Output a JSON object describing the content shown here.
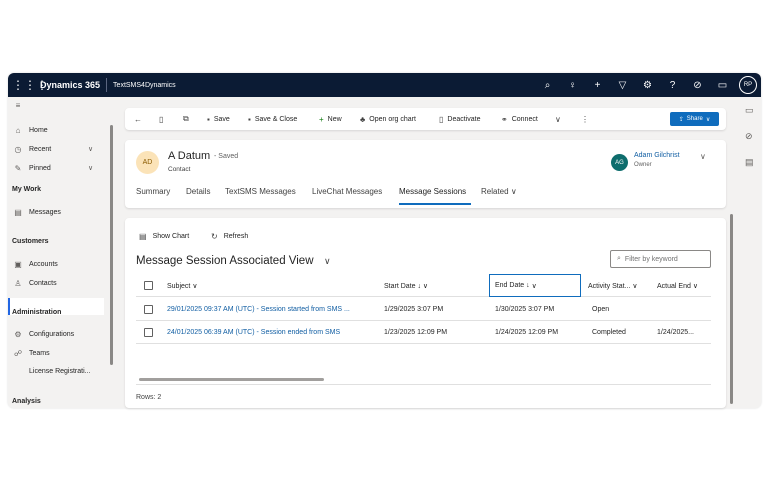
{
  "topbar": {
    "product": "Dynamics 365",
    "app_name": "TextSMS4Dynamics",
    "icons": [
      "search-icon",
      "lightbulb-icon",
      "plus-icon",
      "filter-icon",
      "settings-icon",
      "help-icon",
      "remote-assist-icon",
      "chat-icon"
    ],
    "user_initials": "RP"
  },
  "sidebar": {
    "home": "Home",
    "recent": "Recent",
    "pinned": "Pinned",
    "my_work_heading": "My Work",
    "messages": "Messages",
    "customers_heading": "Customers",
    "accounts": "Accounts",
    "contacts": "Contacts",
    "administration_heading": "Administration",
    "configurations": "Configurations",
    "teams": "Teams",
    "license": "License Registrati...",
    "analysis_heading": "Analysis"
  },
  "commandbar": {
    "save": "Save",
    "save_close": "Save & Close",
    "new": "New",
    "org_chart": "Open org chart",
    "deactivate": "Deactivate",
    "connect": "Connect",
    "share": "Share"
  },
  "record": {
    "initials": "AD",
    "name": "A Datum",
    "saved_status": "- Saved",
    "entity": "Contact",
    "owner_initials": "AG",
    "owner_name": "Adam Gilchrist",
    "owner_role": "Owner"
  },
  "tabs": [
    "Summary",
    "Details",
    "TextSMS Messages",
    "LiveChat Messages",
    "Message Sessions",
    "Related"
  ],
  "active_tab": "Message Sessions",
  "grid": {
    "show_chart": "Show Chart",
    "refresh": "Refresh",
    "view_title": "Message Session Associated View",
    "filter_placeholder": "Filter by keyword",
    "columns": {
      "subject": "Subject",
      "start_date": "Start Date",
      "end_date": "End Date",
      "activity_status": "Activity Stat...",
      "actual_end": "Actual End"
    },
    "rows": [
      {
        "subject": "29/01/2025 09:37 AM (UTC) - Session started from SMS ...",
        "start_date": "1/29/2025 3:07 PM",
        "end_date": "1/30/2025 3:07 PM",
        "activity_status": "Open",
        "actual_end": ""
      },
      {
        "subject": "24/01/2025 06:39 AM (UTC) - Session ended from SMS",
        "start_date": "1/23/2025 12:09 PM",
        "end_date": "1/24/2025 12:09 PM",
        "activity_status": "Completed",
        "actual_end": "1/24/2025..."
      }
    ],
    "row_count": "Rows: 2"
  }
}
